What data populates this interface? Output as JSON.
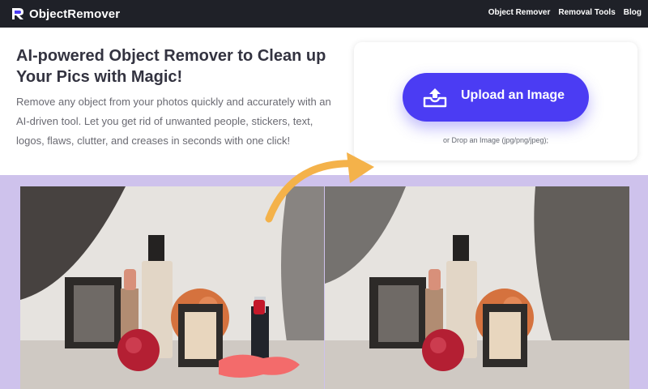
{
  "header": {
    "brand": "ObjectRemover",
    "nav": [
      "Object Remover",
      "Removal Tools",
      "Blog"
    ]
  },
  "hero": {
    "title": "AI-powered Object Remover to Clean up Your Pics with Magic!",
    "description": "Remove any object from your photos quickly and accurately with an AI-driven tool. Let you get rid of unwanted people, stickers, text, logos, flaws, clutter, and creases in seconds with one click!"
  },
  "upload": {
    "button_label": "Upload an Image",
    "drop_hint": "or Drop an Image (jpg/png/jpeg);"
  },
  "colors": {
    "topbar": "#1f2128",
    "accent": "#4b3cf3",
    "band": "#cec2ec",
    "arrow": "#f4b24a",
    "highlight": "#f36b6b"
  },
  "icons": {
    "upload": "tray-upload-icon",
    "arrow": "curved-arrow-icon"
  }
}
